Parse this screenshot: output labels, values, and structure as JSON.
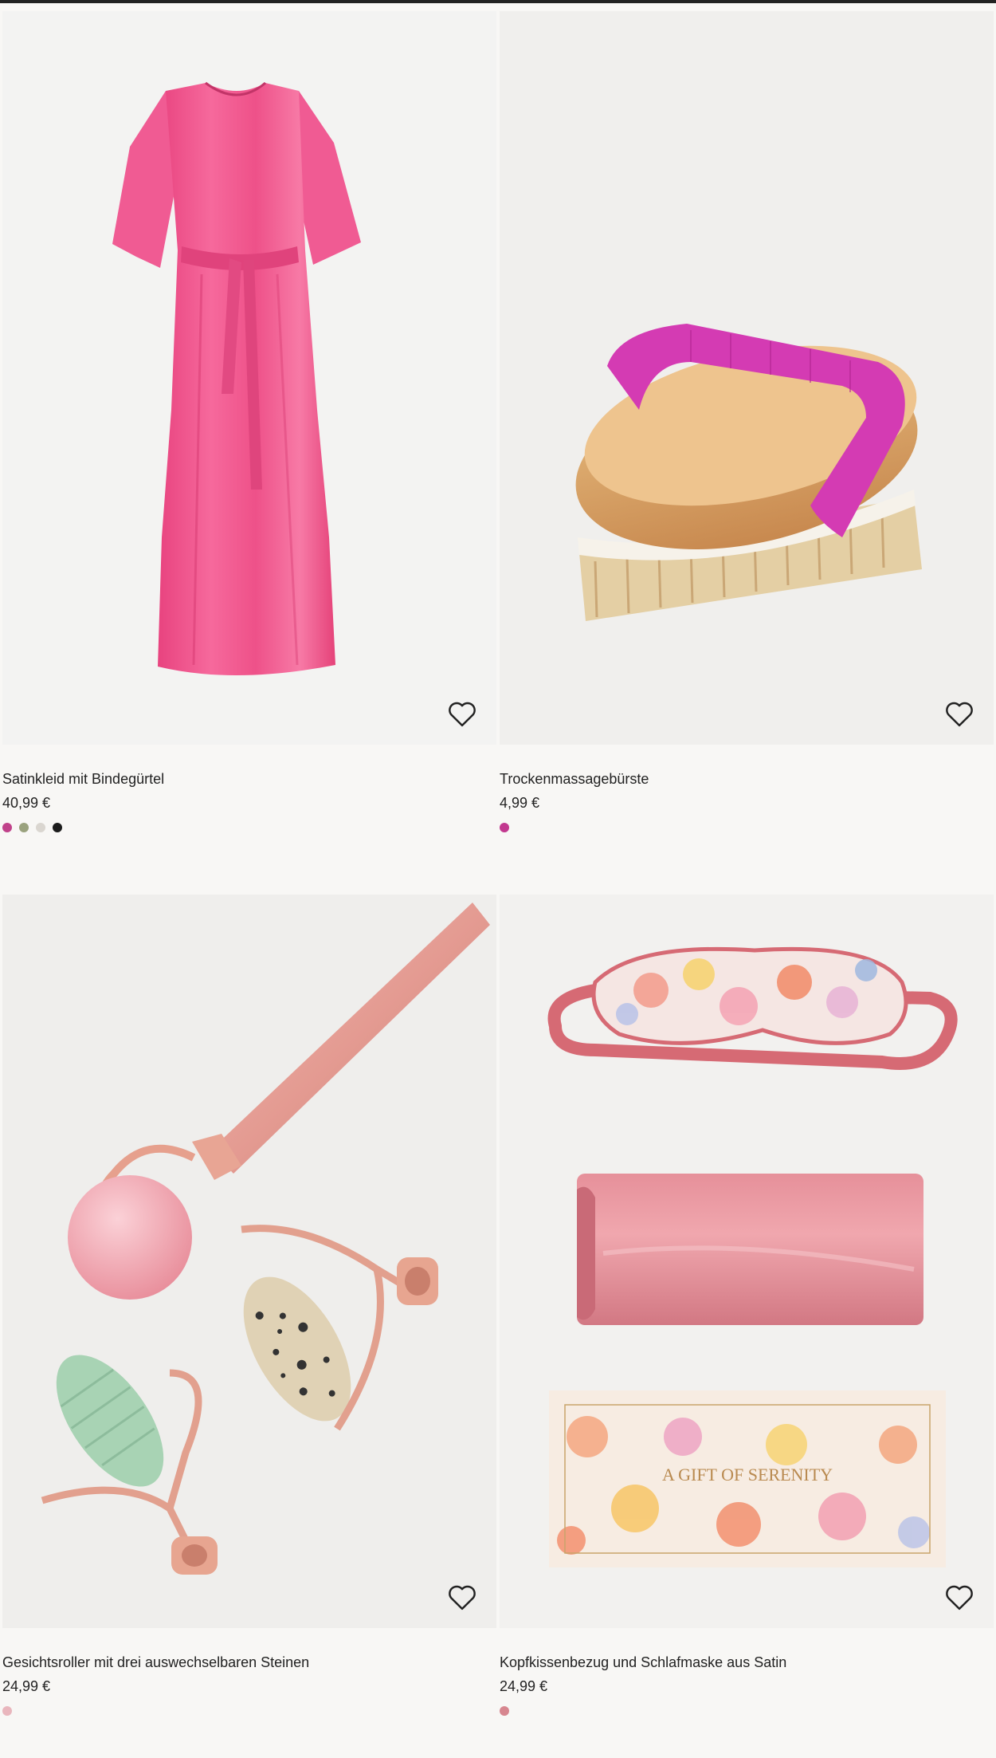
{
  "products": [
    {
      "name": "Satinkleid mit Bindegürtel",
      "price": "40,99 €",
      "swatches": [
        "#c0428a",
        "#9aa27e",
        "#dad6d0",
        "#1c1c1c"
      ],
      "image": "pink-satin-dress"
    },
    {
      "name": "Trockenmassagebürste",
      "price": "4,99 €",
      "swatches": [
        "#c2388f"
      ],
      "image": "wooden-body-brush"
    },
    {
      "name": "Gesichtsroller mit drei auswechselbaren Steinen",
      "price": "24,99 €",
      "swatches": [
        "#e9b6bd"
      ],
      "image": "face-roller-set"
    },
    {
      "name": "Kopfkissenbezug und Schlafmaske aus Satin",
      "price": "24,99 €",
      "swatches": [
        "#d7868f"
      ],
      "image": "satin-pillowcase-and-sleep-mask",
      "packaging_text": "A GIFT OF SERENITY"
    }
  ],
  "icons": {
    "favorite": "heart-outline-icon"
  }
}
